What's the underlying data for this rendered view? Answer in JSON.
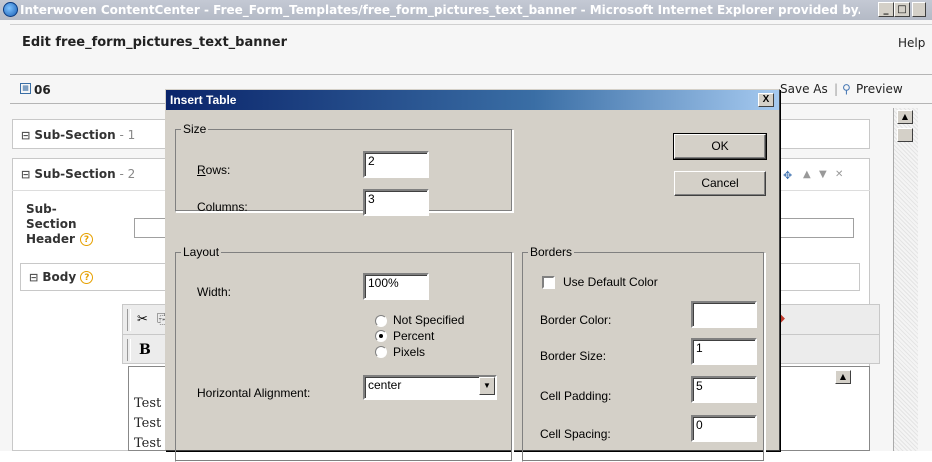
{
  "window": {
    "title": "Interwoven ContentCenter - Free_Form_Templates/free_form_pictures_text_banner - Microsoft Internet Explorer provided by...",
    "minimize_icon": "minimize-icon",
    "maximize_icon": "maximize-icon",
    "close_icon": "close-icon"
  },
  "page": {
    "edit_title": "Edit free_form_pictures_text_banner",
    "help": "Help",
    "item_id": "06",
    "toolbar": {
      "save_as": "Save As",
      "preview": "Preview"
    },
    "sections": [
      {
        "toggle": "⊟",
        "label": "Sub-Section",
        "suffix": " - 1"
      },
      {
        "toggle": "⊟",
        "label": "Sub-Section",
        "suffix": " - 2"
      }
    ],
    "subsection_header_label": "Sub- Section Header",
    "body_label": "Body",
    "help_icon_glyph": "?",
    "editor": {
      "bold_label": "B",
      "lines": [
        "Test",
        "Test",
        "Test"
      ]
    }
  },
  "dialog": {
    "title": "Insert Table",
    "close_glyph": "X",
    "size_group": "Size",
    "rows_label": "Rows:",
    "rows_value": "2",
    "columns_label": "Columns:",
    "columns_value": "3",
    "ok": "OK",
    "cancel": "Cancel",
    "layout_group": "Layout",
    "width_label": "Width:",
    "width_value": "100%",
    "width_options": [
      "Not Specified",
      "Percent",
      "Pixels"
    ],
    "width_selected": "Percent",
    "halign_label": "Horizontal Alignment:",
    "halign_value": "center",
    "borders_group": "Borders",
    "use_default_color": "Use Default Color",
    "border_color_label": "Border Color:",
    "border_color_value": "",
    "border_size_label": "Border Size:",
    "border_size_value": "1",
    "cell_padding_label": "Cell Padding:",
    "cell_padding_value": "5",
    "cell_spacing_label": "Cell Spacing:",
    "cell_spacing_value": "0"
  }
}
